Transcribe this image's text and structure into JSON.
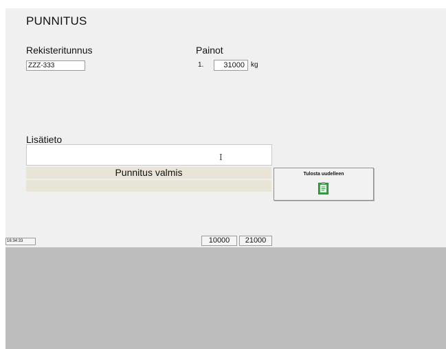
{
  "form": {
    "title": "PUNNITUS",
    "registration": {
      "label": "Rekisteritunnus",
      "value": "ZZZ-333"
    },
    "weights": {
      "label": "Painot",
      "items": [
        {
          "index": "1.",
          "value": "31000",
          "unit": "kg"
        }
      ]
    },
    "info": {
      "label": "Lisätieto",
      "value": ""
    },
    "status": "Punnitus valmis",
    "print_button": {
      "label": "Tulosta uudelleen",
      "icon": "document-print-icon"
    }
  },
  "footer": {
    "time": "16:34:33",
    "totals": [
      "10000",
      "21000"
    ]
  },
  "colors": {
    "status_bar": "#e9e5d6",
    "lower_area": "#bdbdbd",
    "panel": "#f0f0f0",
    "icon_green": "#3aa34a"
  }
}
